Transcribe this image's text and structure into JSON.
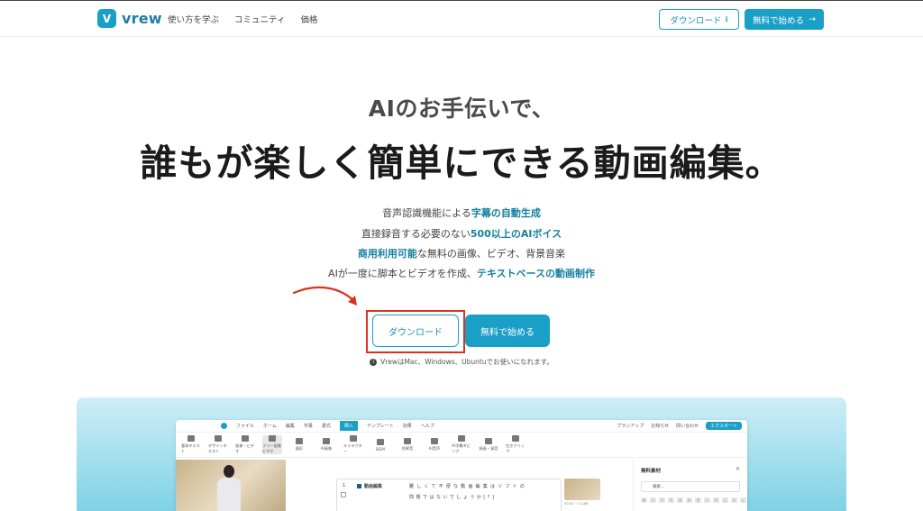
{
  "header": {
    "logo_mark": "V",
    "logo_text": "vrew",
    "nav": [
      "使い方を学ぶ",
      "コミュニティ",
      "価格"
    ],
    "download_label": "ダウンロード",
    "download_icon": "⭳",
    "free_label": "無料で始める",
    "free_icon": "→"
  },
  "hero": {
    "subtitle": "AIのお手伝いで、",
    "title": "誰もが楽しく簡単にできる動画編集。",
    "features": [
      {
        "pre": "音声認識機能による",
        "hl": "字幕の自動生成",
        "post": ""
      },
      {
        "pre": "直接録音する必要のない",
        "hl": "500以上のAIボイス",
        "post": ""
      },
      {
        "pre": "",
        "hl": "商用利用可能",
        "post": "な無料の画像、ビデオ、背景音楽"
      },
      {
        "pre": "AIが一度に脚本とビデオを作成、",
        "hl": "テキストベースの動画制作",
        "post": ""
      }
    ],
    "download_label": "ダウンロード",
    "free_label": "無料で始める",
    "note": "VrewはMac、Windows、Ubuntuでお使いになれます。",
    "note_icon": "i"
  },
  "app": {
    "menu": [
      "ファイル",
      "ホーム",
      "編集",
      "字幕",
      "書式",
      "挿入",
      "テンプレート",
      "効果",
      "ヘルプ"
    ],
    "menu_active_index": 5,
    "menu_right": [
      "プランアップ",
      "お知らせ",
      "問い合わせ",
      "エクスポート"
    ],
    "tools": [
      "基本テキスト",
      "デザインテキスト",
      "画像・ビデオ",
      "フリー画像ビデオ",
      "図形",
      "AI画像",
      "キャラクター",
      "BGM",
      "効果音",
      "AI音声",
      "AI字幕ダビング",
      "録画・録音",
      "空きクリップ"
    ],
    "editor": {
      "num": "1",
      "speaker": "動画編集",
      "line1": "難しくて不便な動画編集はソフトの",
      "line2": "問題ではないでしょうか[?]"
    },
    "clip_time": "00:00 ~ 0.14秒",
    "side": {
      "title": "無料素材",
      "close": "✕",
      "search_placeholder": "検索...",
      "tags": [
        "あ",
        "い",
        "う",
        "え",
        "お",
        "か",
        "き",
        "く",
        "け",
        "こ",
        "さ",
        "し",
        "す"
      ]
    }
  },
  "colors": {
    "accent": "#1a9fc7",
    "highlight_text": "#147f9f",
    "annotation_red": "#d9331f"
  }
}
